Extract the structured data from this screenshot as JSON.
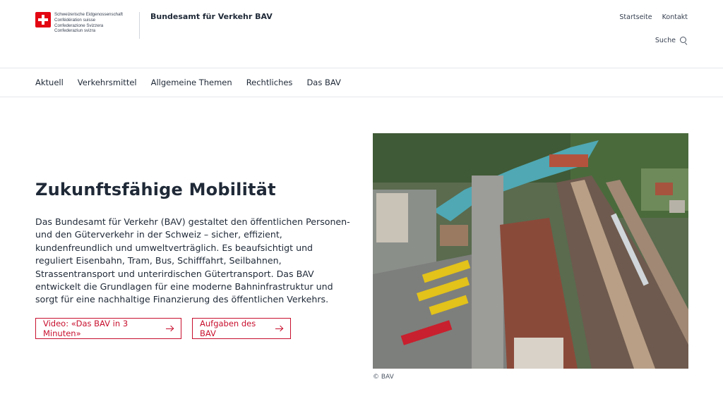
{
  "header": {
    "confederation_lines": [
      "Schweizerische Eidgenossenschaft",
      "Confédération suisse",
      "Confederazione Svizzera",
      "Confederaziun svizra"
    ],
    "office_name": "Bundesamt für Verkehr BAV",
    "meta_links": [
      "Startseite",
      "Kontakt"
    ],
    "search_label": "Suche"
  },
  "nav": {
    "items": [
      "Aktuell",
      "Verkehrsmittel",
      "Allgemeine Themen",
      "Rechtliches",
      "Das BAV"
    ]
  },
  "hero": {
    "title": "Zukunftsfähige Mobilität",
    "text": "Das Bundesamt für Verkehr (BAV) gestaltet den öffentlichen Personen- und den Güterverkehr in der Schweiz – sicher, effizient, kundenfreundlich und umweltverträglich. Es beaufsichtigt und reguliert Eisenbahn, Tram, Bus, Schifffahrt, Seilbahnen, Strassentransport und unterirdischen Gütertransport. Das BAV entwickelt die Grundlagen für eine moderne Bahninfrastruktur und sorgt für eine nachhaltige Finanzierung des öffentlichen Verkehrs.",
    "button_video": "Video: «Das BAV in 3 Minuten»",
    "button_tasks": "Aufgaben des BAV",
    "image_credit": "© BAV"
  },
  "colors": {
    "accent": "#c8102e",
    "swiss_red": "#e30613",
    "text": "#1f2937"
  },
  "icons": [
    "swiss-cross-icon",
    "search-icon",
    "arrow-right-icon"
  ]
}
